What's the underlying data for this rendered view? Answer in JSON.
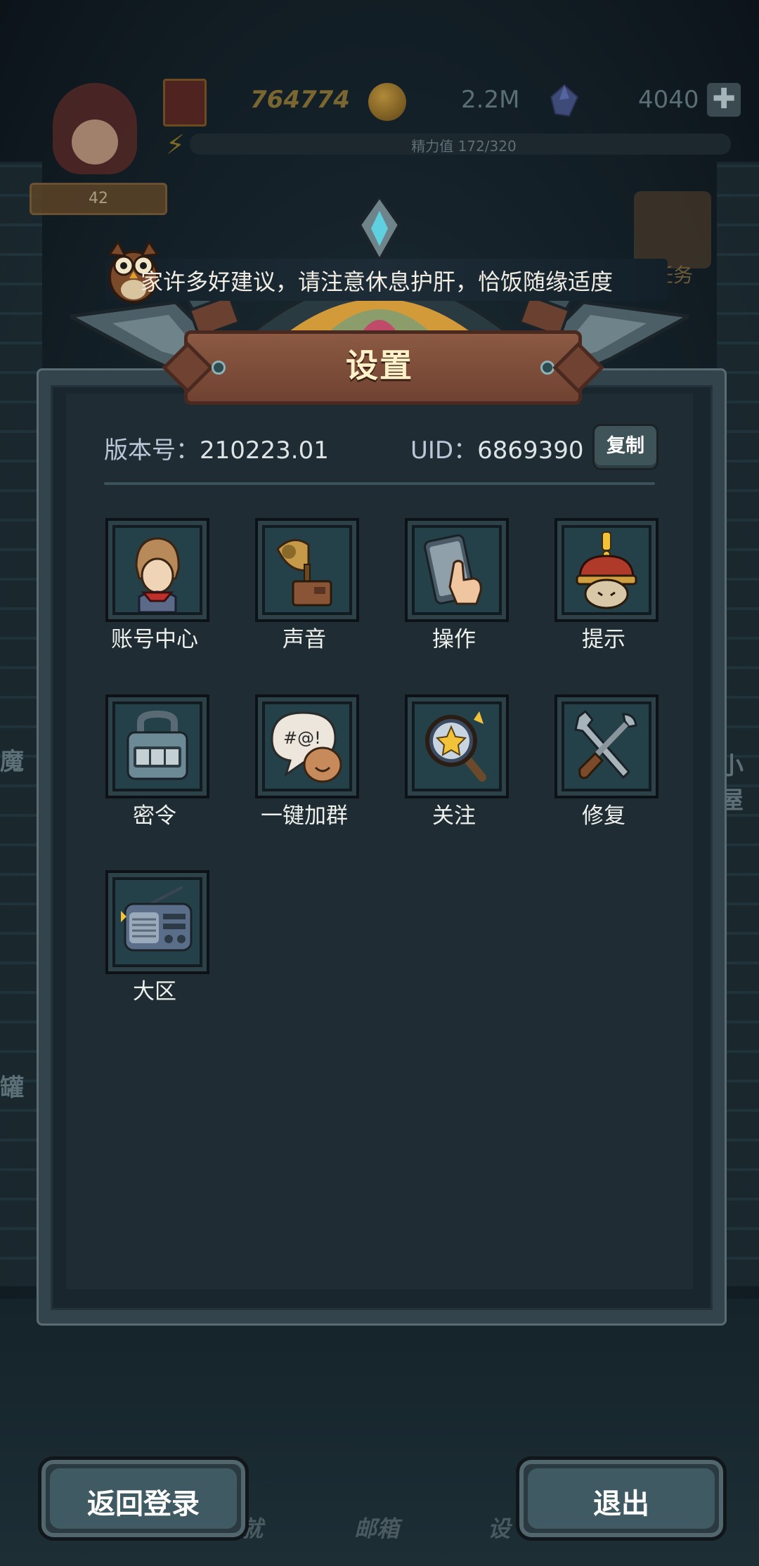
{
  "hud": {
    "level": "42",
    "gold": "764774",
    "coins": "2.2M",
    "gems": "4040",
    "plus": "✚",
    "energy": "精力值 172/320",
    "task": "任务"
  },
  "notice": "家许多好建议，请注意休息护肝，恰饭随缘适度",
  "background_labels": {
    "left_1": "魔",
    "left_2": "罐",
    "right_1": "小屋"
  },
  "settings": {
    "title": "设置",
    "version_label": "版本号：",
    "version_value": "210223.01",
    "uid_label": "UID：",
    "uid_value": "6869390",
    "copy_button": "复制",
    "items": [
      {
        "label": "账号中心",
        "icon": "account-icon"
      },
      {
        "label": "声音",
        "icon": "gramophone-icon"
      },
      {
        "label": "操作",
        "icon": "touch-phone-icon"
      },
      {
        "label": "提示",
        "icon": "hint-helmet-icon"
      },
      {
        "label": "密令",
        "icon": "code-lock-icon"
      },
      {
        "label": "一键加群",
        "icon": "chat-bubble-icon"
      },
      {
        "label": "关注",
        "icon": "magnifier-star-icon"
      },
      {
        "label": "修复",
        "icon": "repair-tools-icon"
      },
      {
        "label": "大区",
        "icon": "radio-icon"
      }
    ]
  },
  "bottom_nav_dimmed": {
    "item_1": "就",
    "item_2": "邮箱",
    "item_3": "设"
  },
  "buttons": {
    "back_to_login": "返回登录",
    "exit": "退出"
  },
  "colors": {
    "panel_bg": "#1f2c33",
    "plaque": "#8c5a43",
    "button_face": "#3f5a62",
    "tile_bg": "#244048"
  }
}
